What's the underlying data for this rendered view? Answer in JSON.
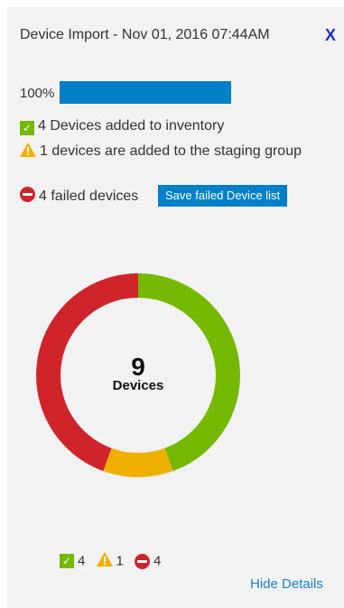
{
  "header": {
    "title": "Device Import - Nov 01, 2016 07:44AM",
    "close_label": "X"
  },
  "progress": {
    "label": "100%",
    "value": 100
  },
  "status": {
    "added": "4 Devices added to inventory",
    "staging": "1 devices are added to the staging group",
    "failed": "4 failed devices",
    "save_failed_label": "Save failed Device list"
  },
  "donut": {
    "count": "9",
    "label": "Devices"
  },
  "chart_data": {
    "type": "pie",
    "categories": [
      "added",
      "staging",
      "failed"
    ],
    "values": [
      4,
      1,
      4
    ],
    "colors": [
      "#74b800",
      "#f0b000",
      "#d0242b"
    ]
  },
  "legend": {
    "added_count": "4",
    "staging_count": "1",
    "failed_count": "4"
  },
  "footer": {
    "hide_details": "Hide Details"
  },
  "icons": {
    "added": "check-icon",
    "staging": "warning-icon",
    "failed": "error-icon"
  }
}
